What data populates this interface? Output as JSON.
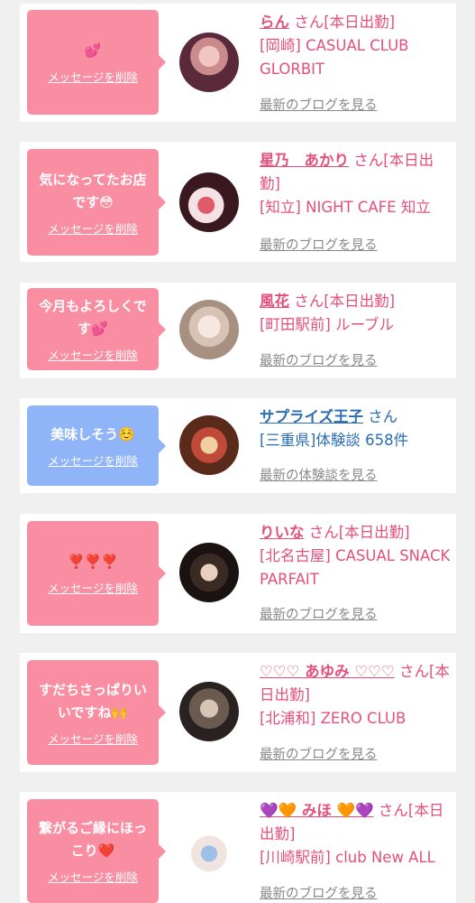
{
  "items": [
    {
      "message": "💕",
      "delete_label": "メッセージを削除",
      "name": "らん",
      "suffix": "さん[本日出勤]",
      "shop": "[岡崎] CASUAL CLUB GLORBIT",
      "link": "最新のブログを見る",
      "color": "#f98ea2"
    },
    {
      "message": "気になってたお店です😳",
      "delete_label": "メッセージを削除",
      "name": "星乃　あかり",
      "suffix": "さん[本日出勤]",
      "shop": "[知立] NIGHT CAFE 知立",
      "link": "最新のブログを見る",
      "color": "#f98ea2"
    },
    {
      "message": "今月もよろしくです💕",
      "delete_label": "メッセージを削除",
      "name": "風花",
      "suffix": "さん[本日出勤]",
      "shop": "[町田駅前] ルーブル",
      "link": "最新のブログを見る",
      "color": "#f98ea2"
    },
    {
      "message": "美味しそう☺️",
      "delete_label": "メッセージを削除",
      "name": "サプライズ王子",
      "suffix": "さん",
      "shop": "[三重県]体験談 658件",
      "link": "最新の体験談を見る",
      "color": "#8fb4f7"
    },
    {
      "message": "❣️❣️❣️",
      "delete_label": "メッセージを削除",
      "name": "りいな",
      "suffix": "さん[本日出勤]",
      "shop": "[北名古屋] CASUAL SNACK PARFAIT",
      "link": "最新のブログを見る",
      "color": "#f98ea2"
    },
    {
      "message": "すだちさっぱりいいですね🙌",
      "delete_label": "メッセージを削除",
      "name": "♡♡♡ あゆみ ♡♡♡",
      "suffix": "さん[本日出勤]",
      "shop": "[北浦和] ZERO CLUB",
      "link": "最新のブログを見る",
      "color": "#f98ea2"
    },
    {
      "message": "繋がるご縁にほっこり❤️",
      "delete_label": "メッセージを削除",
      "name": "💜🧡 みほ 🧡💜",
      "suffix": "さん[本日出勤]",
      "shop": "[川崎駅前] club New ALL",
      "link": "最新のブログを見る",
      "color": "#f98ea2"
    }
  ]
}
